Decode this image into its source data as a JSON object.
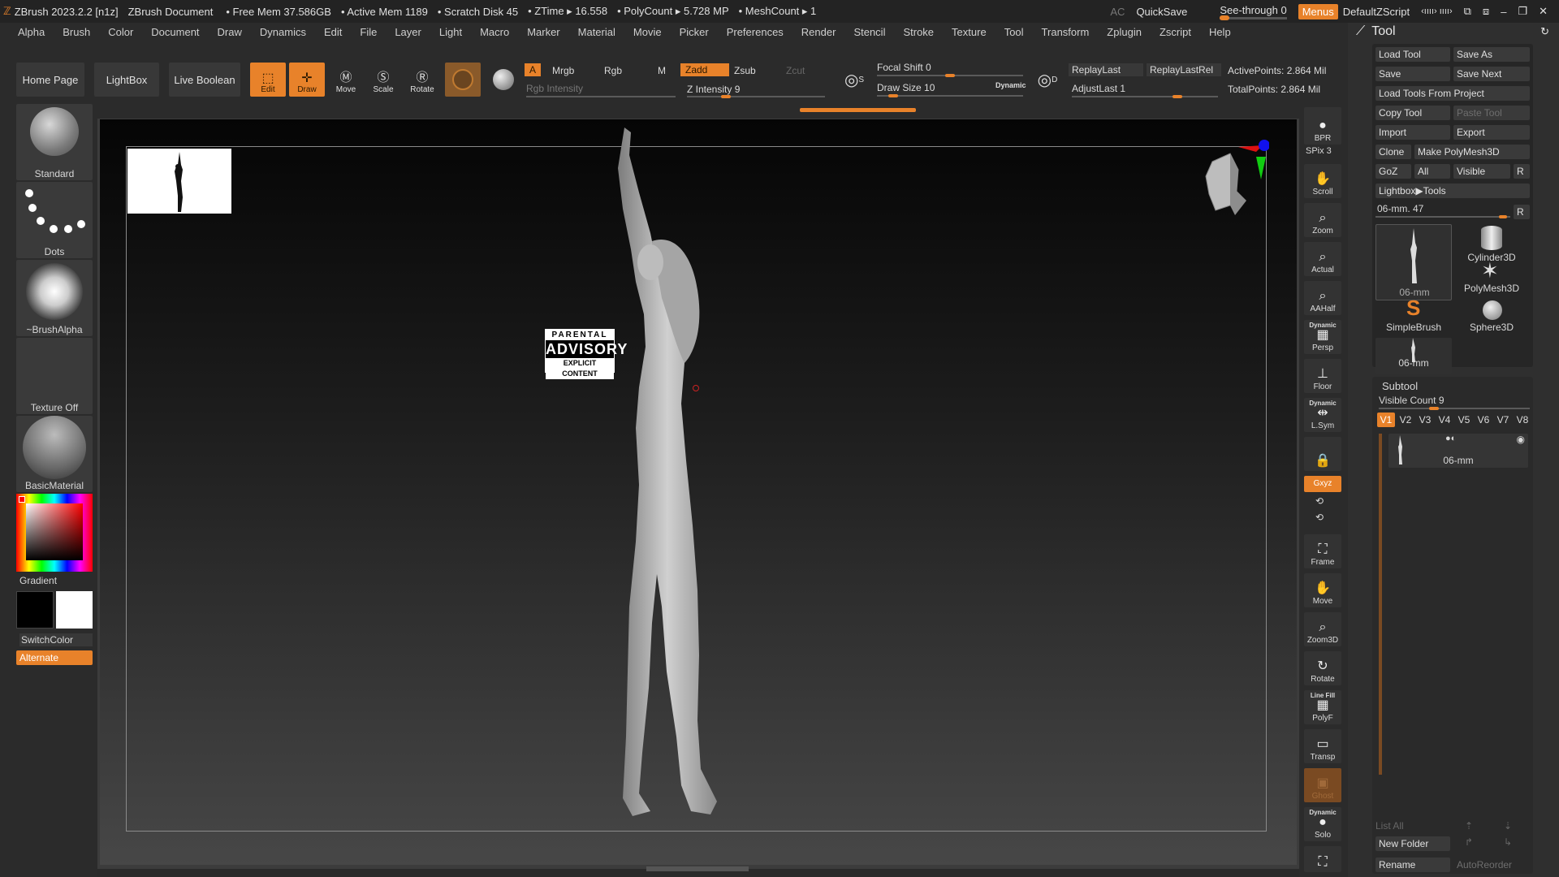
{
  "titlebar": {
    "app": "ZBrush 2023.2.2 [n1z]",
    "document": "ZBrush Document",
    "free_mem": "• Free Mem 37.586GB",
    "active_mem": "• Active Mem 1189",
    "scratch_disk": "• Scratch Disk 45",
    "ztime": "• ZTime ▸ 16.558",
    "polycount": "• PolyCount ▸ 5.728 MP",
    "meshcount": "• MeshCount ▸ 1",
    "ac": "AC",
    "quicksave": "QuickSave",
    "see_through": "See-through  0",
    "menus": "Menus",
    "zscript": "DefaultZScript",
    "arrows": "‹ıııı› ıııı›"
  },
  "menubar": [
    "Alpha",
    "Brush",
    "Color",
    "Document",
    "Draw",
    "Dynamics",
    "Edit",
    "File",
    "Layer",
    "Light",
    "Macro",
    "Marker",
    "Material",
    "Movie",
    "Picker",
    "Preferences",
    "Render",
    "Stencil",
    "Stroke",
    "Texture",
    "Tool",
    "Transform",
    "Zplugin",
    "Zscript",
    "Help"
  ],
  "toolbar": {
    "home_page": "Home Page",
    "lightbox": "LightBox",
    "live_boolean": "Live Boolean",
    "edit": "Edit",
    "draw": "Draw",
    "move": "Move",
    "scale": "Scale",
    "rotate": "Rotate",
    "a": "A",
    "mrgb": "Mrgb",
    "rgb": "Rgb",
    "m": "M",
    "zadd": "Zadd",
    "zsub": "Zsub",
    "zcut": "Zcut",
    "rgb_intensity": "Rgb Intensity",
    "z_intensity": "Z Intensity 9",
    "focal_shift": "Focal Shift 0",
    "draw_size": "Draw Size 10",
    "dynamic": "Dynamic",
    "replay_last": "ReplayLast",
    "replay_last_rel": "ReplayLastRel",
    "adjust_last": "AdjustLast 1",
    "active_points": "ActivePoints: 2.864 Mil",
    "total_points": "TotalPoints: 2.864 Mil",
    "s_label": "S",
    "d_label": "D"
  },
  "leftshelf": {
    "standard": "Standard",
    "dots": "Dots",
    "brush_alpha": "~BrushAlpha",
    "texture_off": "Texture Off",
    "basic_material": "BasicMaterial",
    "gradient": "Gradient",
    "switch_color": "SwitchColor",
    "alternate": "Alternate"
  },
  "canvas": {
    "advisory_top": "PARENTAL",
    "advisory_mid": "ADVISORY",
    "advisory_bot": "EXPLICIT CONTENT"
  },
  "rightshelf": {
    "bpr": "BPR",
    "spix": "SPix 3",
    "scroll": "Scroll",
    "zoom": "Zoom",
    "actual": "Actual",
    "aahalf": "AAHalf",
    "dynamic_persp_top": "Dynamic",
    "persp": "Persp",
    "floor": "Floor",
    "dynamic_lsym_top": "Dynamic",
    "lsym": "L.Sym",
    "xyz": "Gxyz",
    "frame": "Frame",
    "move": "Move",
    "zoom3d": "Zoom3D",
    "rotate": "Rotate",
    "line_fill": "Line Fill",
    "polyf": "PolyF",
    "transp": "Transp",
    "ghost": "Ghost",
    "dynamic_solo_top": "Dynamic",
    "solo": "Solo"
  },
  "tool": {
    "title": "Tool",
    "load_tool": "Load Tool",
    "save_as": "Save As",
    "save": "Save",
    "save_next": "Save Next",
    "load_from_project": "Load Tools From Project",
    "copy_tool": "Copy Tool",
    "paste_tool": "Paste Tool",
    "import": "Import",
    "export": "Export",
    "clone": "Clone",
    "make_polymesh": "Make PolyMesh3D",
    "goz": "GoZ",
    "all": "All",
    "visible": "Visible",
    "r": "R",
    "lightbox_tools": "Lightbox▶Tools",
    "current_tool": "06-mm. 47",
    "thumbs": [
      "06-mm",
      "Cylinder3D",
      "PolyMesh3D",
      "SimpleBrush",
      "Sphere3D",
      "06-mm"
    ],
    "subtool_title": "Subtool",
    "visible_count": "Visible Count 9",
    "vtabs": [
      "V1",
      "V2",
      "V3",
      "V4",
      "V5",
      "V6",
      "V7",
      "V8"
    ],
    "subtool_name": "06-mm",
    "list_all": "List All",
    "new_folder": "New Folder",
    "rename": "Rename",
    "auto_reorder": "AutoReorder"
  }
}
